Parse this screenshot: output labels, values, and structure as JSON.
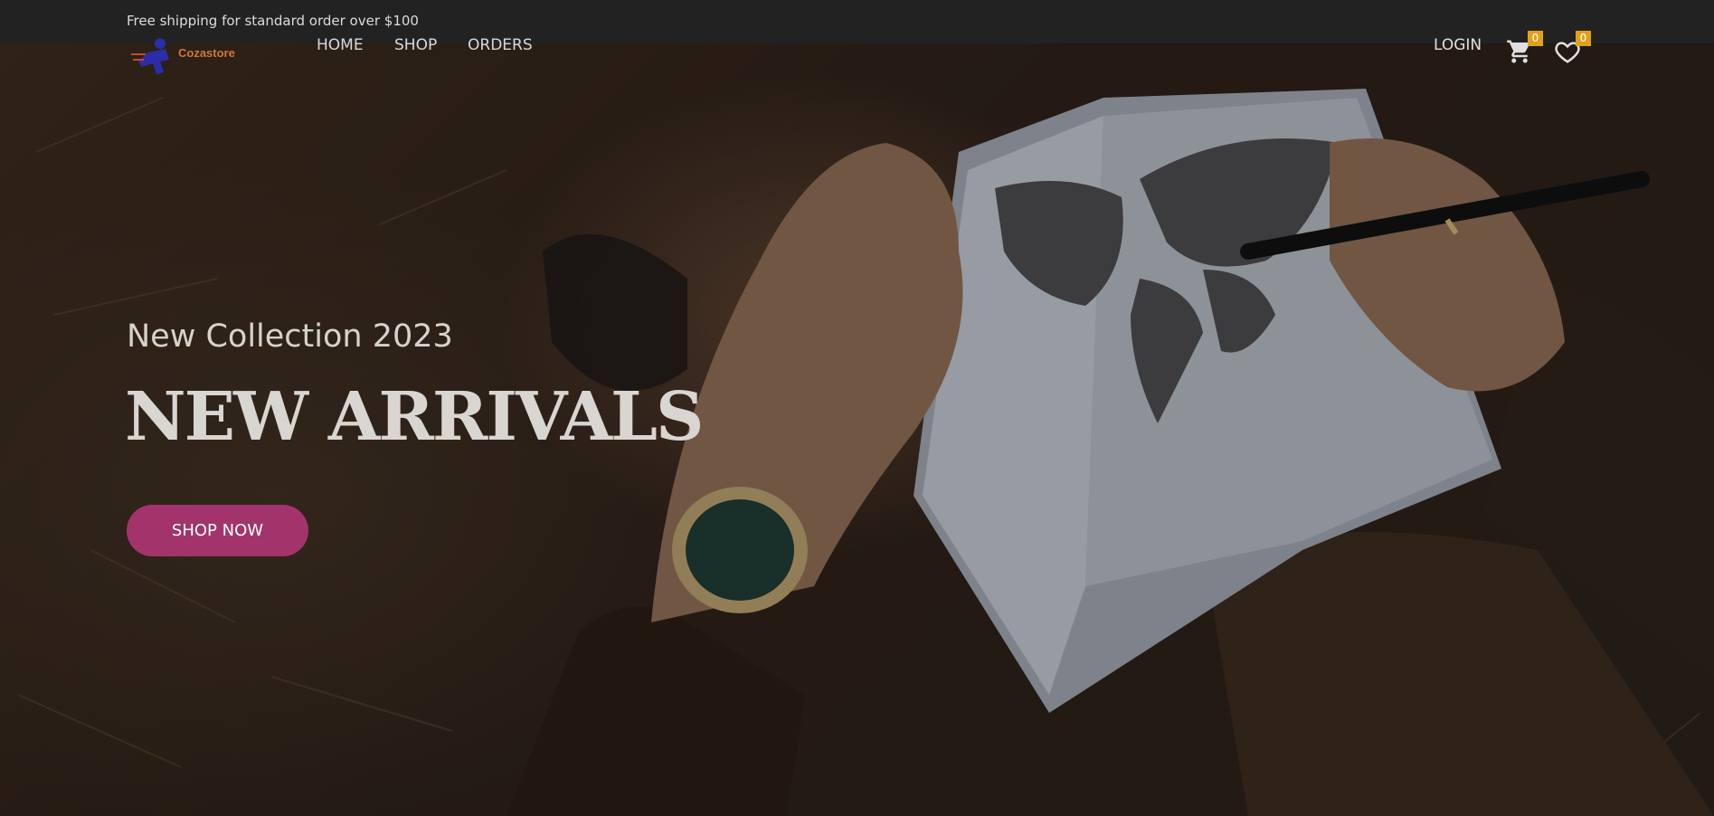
{
  "topbar": {
    "notice": "Free shipping for standard order over $100"
  },
  "brand": {
    "name": "Cozastore",
    "icon": "runner-logo-icon"
  },
  "nav": {
    "items": [
      "HOME",
      "SHOP",
      "ORDERS"
    ]
  },
  "header_actions": {
    "login_label": "LOGIN",
    "cart_icon": "cart-icon",
    "cart_count": "0",
    "wishlist_icon": "heart-icon",
    "wishlist_count": "0"
  },
  "hero": {
    "subtitle": "New Collection 2023",
    "headline": "NEW ARRIVALS",
    "cta_label": "SHOP NOW"
  },
  "colors": {
    "topbar_bg": "#222222",
    "cta_bg": "#a3346b",
    "badge_bg": "#e0a21a",
    "brand_text": "#d2763a"
  }
}
